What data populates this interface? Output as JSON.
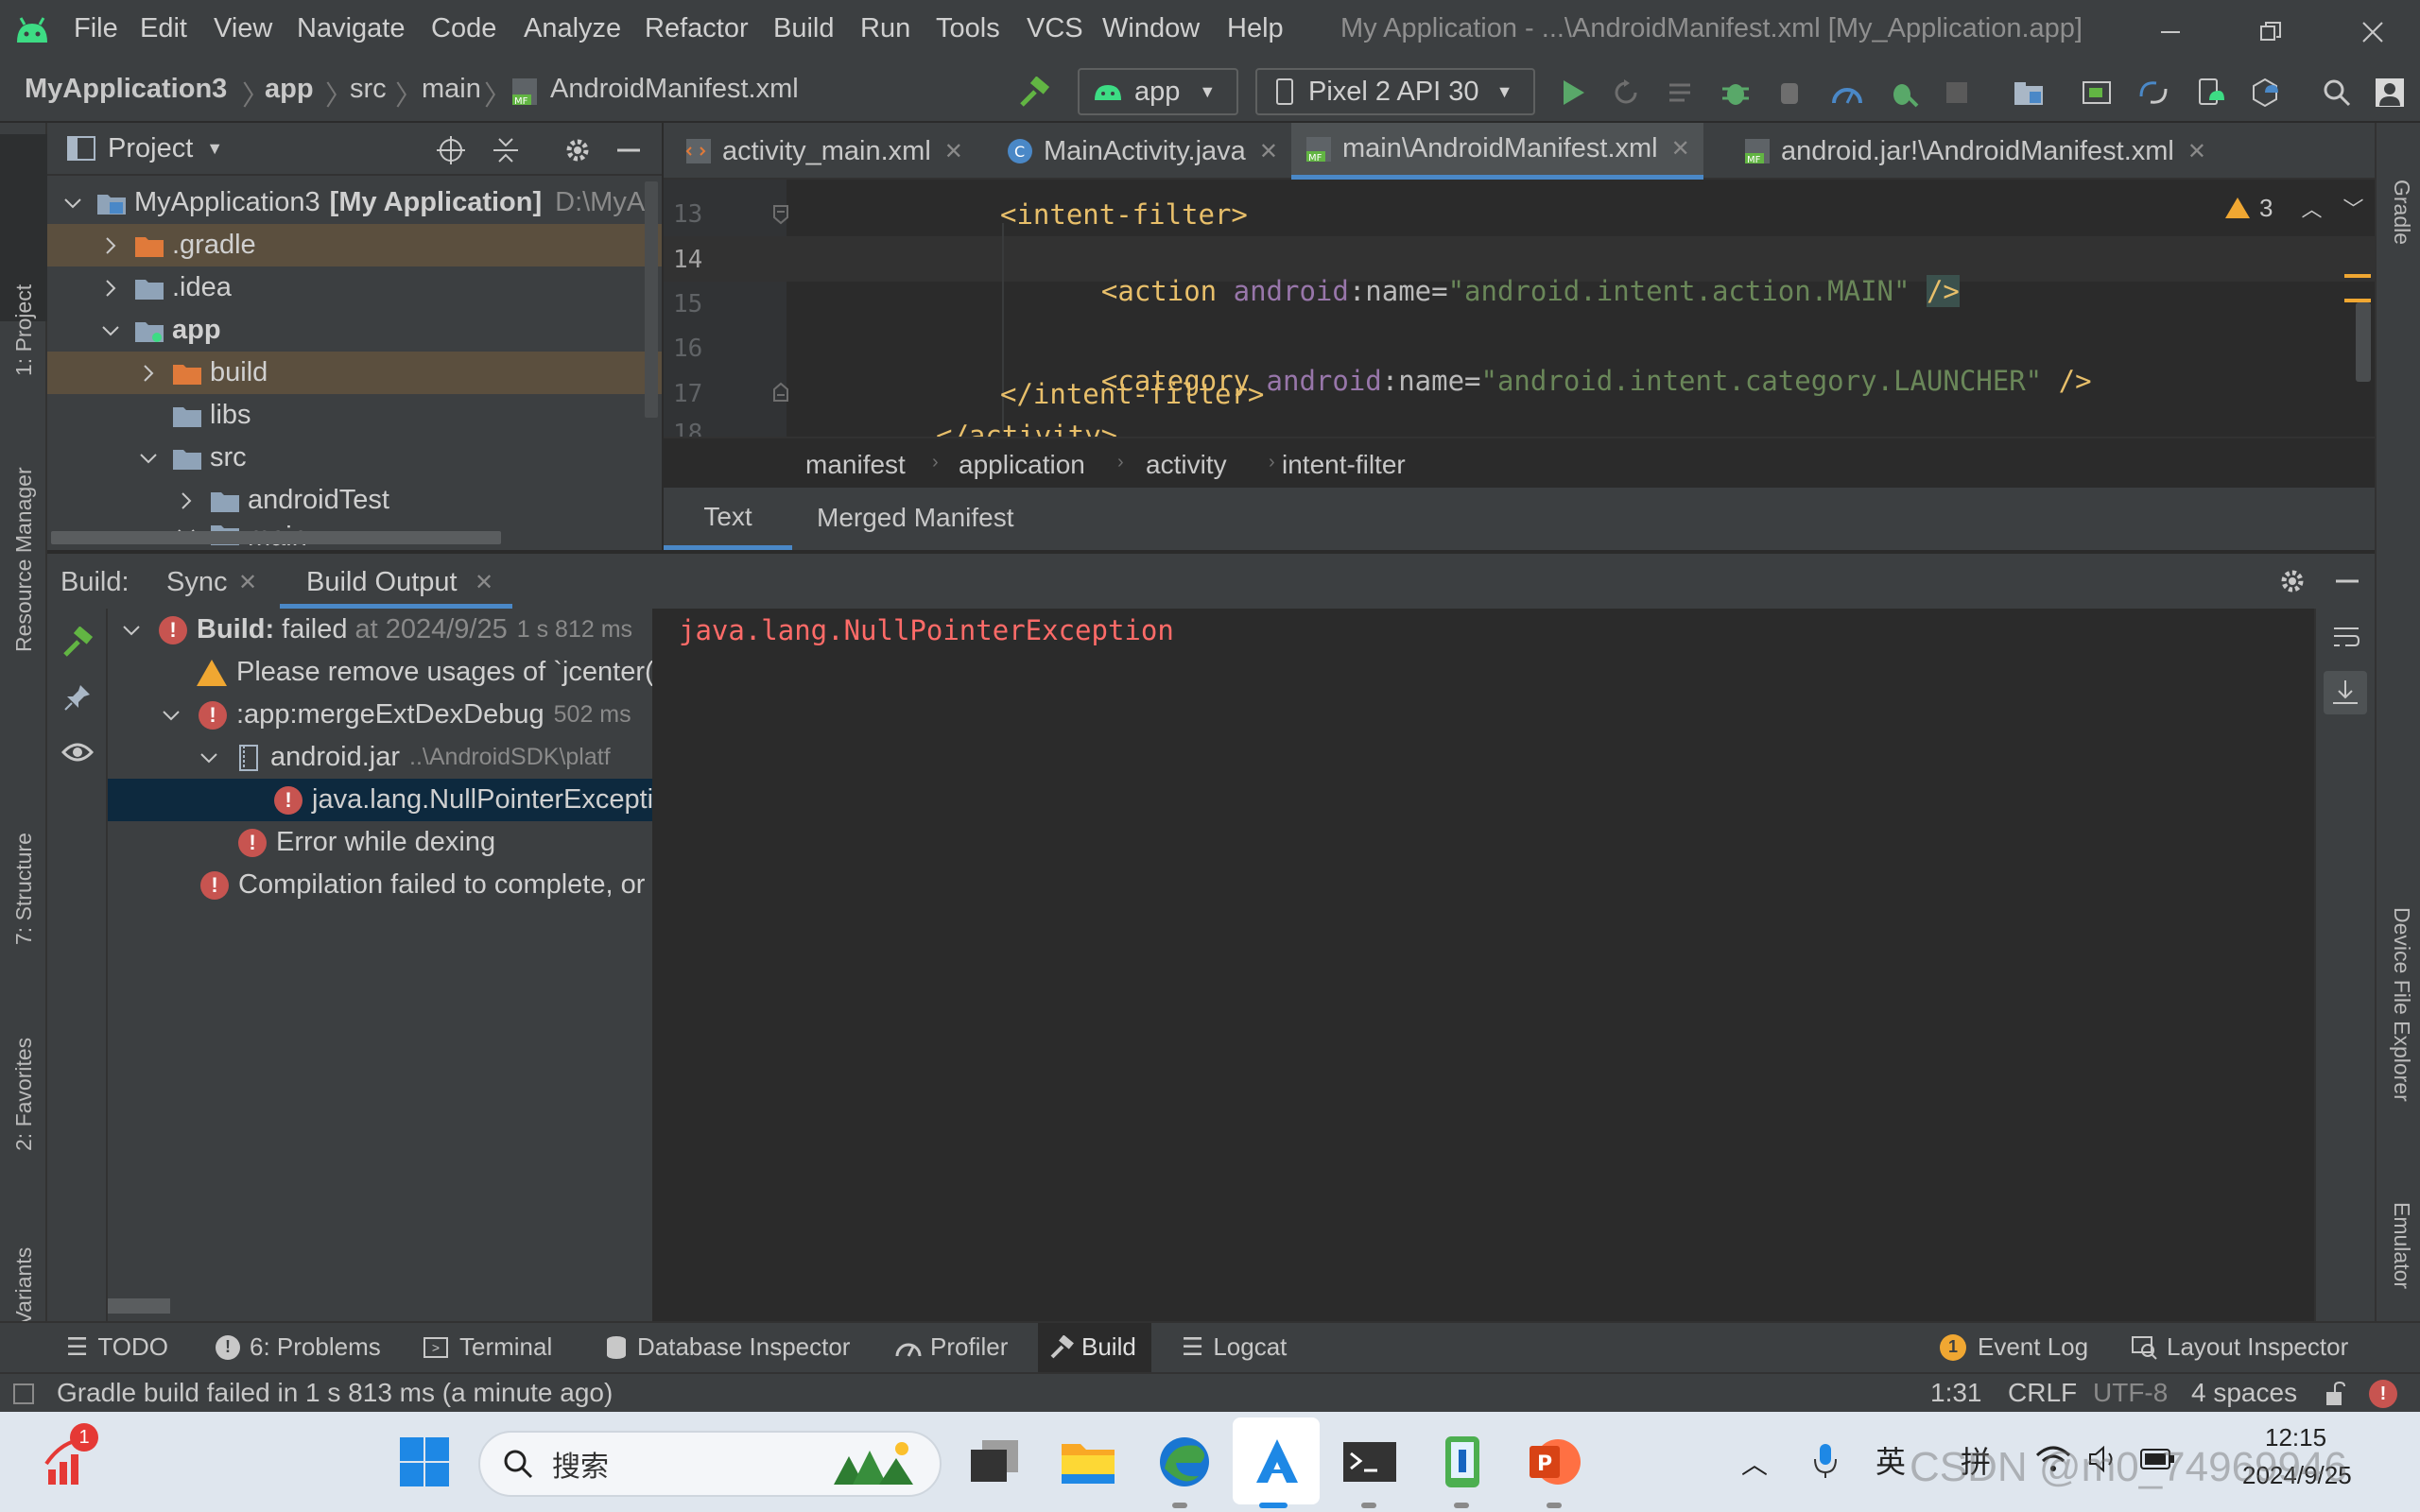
{
  "window": {
    "title": "My Application - ...\\AndroidManifest.xml [My_Application.app]",
    "menu": [
      "File",
      "Edit",
      "View",
      "Navigate",
      "Code",
      "Analyze",
      "Refactor",
      "Build",
      "Run",
      "Tools",
      "VCS",
      "Window",
      "Help"
    ]
  },
  "navbar": {
    "breadcrumbs": [
      "MyApplication3",
      "app",
      "src",
      "main",
      "AndroidManifest.xml"
    ],
    "run_config": "app",
    "device": "Pixel 2 API 30"
  },
  "project_panel": {
    "title": "Project",
    "tree": [
      {
        "label": "MyApplication3",
        "bold": "[My Application]",
        "path": "D:\\MyA"
      },
      {
        "label": ".gradle"
      },
      {
        "label": ".idea"
      },
      {
        "label": "app"
      },
      {
        "label": "build"
      },
      {
        "label": "libs"
      },
      {
        "label": "src"
      },
      {
        "label": "androidTest"
      },
      {
        "label": "main"
      }
    ]
  },
  "left_strip": [
    "1: Project",
    "Resource Manager",
    "7: Structure",
    "2: Favorites",
    "Build Variants"
  ],
  "right_strip": [
    "Gradle",
    "Device File Explorer",
    "Emulator"
  ],
  "editor": {
    "tabs": [
      "activity_main.xml",
      "MainActivity.java",
      "main\\AndroidManifest.xml",
      "android.jar!\\AndroidManifest.xml"
    ],
    "active_tab": 2,
    "warnings_count": "3",
    "line_numbers": [
      "13",
      "14",
      "15",
      "16",
      "17",
      "18"
    ],
    "lines": {
      "l13": "<intent-filter>",
      "l14_tag": "<action",
      "l14_ns": "android",
      "l14_attr": ":name=",
      "l14_val": "\"android.intent.action.MAIN\"",
      "l14_end": "/>",
      "l16_tag": "<category",
      "l16_ns": "android",
      "l16_attr": ":name=",
      "l16_val": "\"android.intent.category.LAUNCHER\"",
      "l16_end": "/>",
      "l17": "</intent-filter>",
      "l18": "</activity>"
    },
    "structure_crumbs": [
      "manifest",
      "application",
      "activity",
      "intent-filter"
    ],
    "bottom_tabs": [
      "Text",
      "Merged Manifest"
    ]
  },
  "build_panel": {
    "label": "Build:",
    "tabs": [
      "Sync",
      "Build Output"
    ],
    "tree": {
      "root": "Build:",
      "root_status": "failed",
      "root_time": "at 2024/9/25",
      "root_duration": "1 s 812 ms",
      "warn": "Please remove usages of `jcenter()",
      "task": ":app:mergeExtDexDebug",
      "task_duration": "502 ms",
      "jar": "android.jar",
      "jar_path": "..\\AndroidSDK\\platf",
      "npe": "java.lang.NullPointerExcepti",
      "dexing": "Error while dexing",
      "compile": "Compilation failed to complete, or"
    },
    "console_text": "java.lang.NullPointerException"
  },
  "tool_windows": {
    "todo": "TODO",
    "problems": "6: Problems",
    "terminal": "Terminal",
    "database": "Database Inspector",
    "profiler": "Profiler",
    "build": "Build",
    "logcat": "Logcat",
    "event_log": "Event Log",
    "event_count": "1",
    "layout_inspector": "Layout Inspector"
  },
  "status_bar": {
    "message": "Gradle build failed in 1 s 813 ms (a minute ago)",
    "position": "1:31",
    "line_sep": "CRLF",
    "encoding": "UTF-8",
    "indent": "4 spaces"
  },
  "taskbar": {
    "search_placeholder": "搜索",
    "badge": "1",
    "ime1": "英",
    "ime2": "拼",
    "time": "12:15",
    "date": "2024/9/25",
    "watermark": "CSDN @m0_74969946"
  },
  "colors": {
    "accent": "#4a88c7",
    "error": "#c75450",
    "warning": "#f0a732",
    "console_error": "#ff6b68"
  }
}
